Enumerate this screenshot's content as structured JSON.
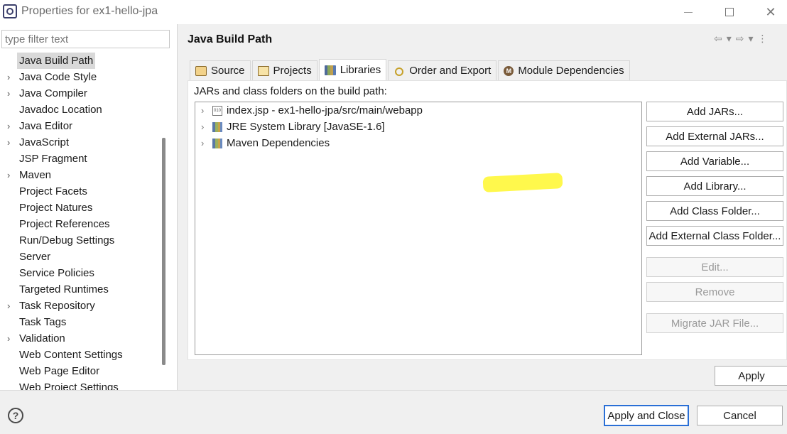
{
  "window": {
    "title": "Properties for ex1-hello-jpa",
    "min_icon": "minimize-icon",
    "max_icon": "maximize-icon",
    "close_icon": "close-icon",
    "close_glyph": "✕"
  },
  "filter": {
    "placeholder": "type filter text"
  },
  "sidebar": {
    "items": [
      {
        "label": "Java Build Path",
        "expandable": false,
        "selected": true
      },
      {
        "label": "Java Code Style",
        "expandable": true
      },
      {
        "label": "Java Compiler",
        "expandable": true
      },
      {
        "label": "Javadoc Location",
        "expandable": false
      },
      {
        "label": "Java Editor",
        "expandable": true
      },
      {
        "label": "JavaScript",
        "expandable": true
      },
      {
        "label": "JSP Fragment",
        "expandable": false
      },
      {
        "label": "Maven",
        "expandable": true
      },
      {
        "label": "Project Facets",
        "expandable": false
      },
      {
        "label": "Project Natures",
        "expandable": false
      },
      {
        "label": "Project References",
        "expandable": false
      },
      {
        "label": "Run/Debug Settings",
        "expandable": false
      },
      {
        "label": "Server",
        "expandable": false
      },
      {
        "label": "Service Policies",
        "expandable": false
      },
      {
        "label": "Targeted Runtimes",
        "expandable": false
      },
      {
        "label": "Task Repository",
        "expandable": true
      },
      {
        "label": "Task Tags",
        "expandable": false
      },
      {
        "label": "Validation",
        "expandable": true
      },
      {
        "label": "Web Content Settings",
        "expandable": false
      },
      {
        "label": "Web Page Editor",
        "expandable": false
      },
      {
        "label": "Web Project Settings",
        "expandable": false
      }
    ],
    "chevron": "›"
  },
  "main": {
    "title": "Java Build Path",
    "nav": {
      "back": "⇦",
      "back_menu": "▾",
      "forward": "⇨",
      "forward_menu": "▾",
      "more": "⋮"
    },
    "tabs": [
      {
        "label": "Source",
        "icon": "source-folder-icon",
        "active": false
      },
      {
        "label": "Projects",
        "icon": "projects-icon",
        "active": false
      },
      {
        "label": "Libraries",
        "icon": "libraries-icon",
        "active": true
      },
      {
        "label": "Order and Export",
        "icon": "order-export-icon",
        "active": false
      },
      {
        "label": "Module Dependencies",
        "icon": "module-icon",
        "active": false
      }
    ],
    "section_label": "JARs and class folders on the build path:",
    "tree": [
      {
        "label": "index.jsp - ex1-hello-jpa/src/main/webapp",
        "icon": "jar-file-icon"
      },
      {
        "label": "JRE System Library [JavaSE-1.6]",
        "icon": "library-icon"
      },
      {
        "label": "Maven Dependencies",
        "icon": "library-icon"
      }
    ],
    "buttons": [
      {
        "label": "Add JARs...",
        "enabled": true
      },
      {
        "label": "Add External JARs...",
        "enabled": true
      },
      {
        "label": "Add Variable...",
        "enabled": true
      },
      {
        "label": "Add Library...",
        "enabled": true
      },
      {
        "label": "Add Class Folder...",
        "enabled": true
      },
      {
        "label": "Add External Class Folder...",
        "enabled": true
      },
      {
        "label": "Edit...",
        "enabled": false
      },
      {
        "label": "Remove",
        "enabled": false
      },
      {
        "label": "Migrate JAR File...",
        "enabled": false
      }
    ],
    "apply_label": "Apply",
    "highlight_color": "#fff500"
  },
  "footer": {
    "help_glyph": "?",
    "apply_close_label": "Apply and Close",
    "cancel_label": "Cancel"
  },
  "colors": {
    "default_button_border": "#2a6fd6",
    "selection_bg": "#d9d9d9"
  }
}
